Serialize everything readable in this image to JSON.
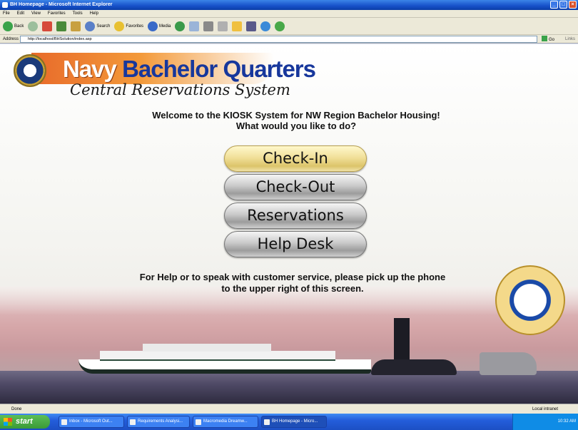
{
  "window": {
    "title": "BH Homepage - Microsoft Internet Explorer",
    "controls": [
      "_",
      "□",
      "×"
    ]
  },
  "menubar": [
    "File",
    "Edit",
    "View",
    "Favorites",
    "Tools",
    "Help"
  ],
  "toolbar": {
    "back": "Back",
    "search": "Search",
    "favorites": "Favorites",
    "media": "Media"
  },
  "address": {
    "label": "Address",
    "url": "http://localhost/BHSolution/index.asp",
    "go": "Go",
    "links": "Links"
  },
  "banner": {
    "word1": "Navy",
    "word2": "Bachelor Quarters",
    "subtitle": "Central Reservations System"
  },
  "welcome": {
    "line1": "Welcome to the KIOSK System for NW Region Bachelor Housing!",
    "line2": "What would you like to do?"
  },
  "actions": [
    {
      "label": "Check-In"
    },
    {
      "label": "Check-Out"
    },
    {
      "label": "Reservations"
    },
    {
      "label": "Help Desk"
    }
  ],
  "help": {
    "line1": "For Help or to speak with customer service, please pick up the phone",
    "line2": "to the upper right of this screen."
  },
  "status": {
    "left": "Done",
    "zone": "Local intranet"
  },
  "taskbar": {
    "start": "start",
    "tasks": [
      {
        "label": "Inbox - Microsoft Out..."
      },
      {
        "label": "Requirements Analysi..."
      },
      {
        "label": "Macromedia Dreamw..."
      },
      {
        "label": "BH Homepage - Micro..."
      }
    ],
    "clock": "10:32 AM"
  },
  "colors": {
    "accent_blue": "#17379c",
    "banner_orange": "#e86a2a",
    "active_button": "#f1e09a",
    "xp_taskbar": "#245edb"
  }
}
